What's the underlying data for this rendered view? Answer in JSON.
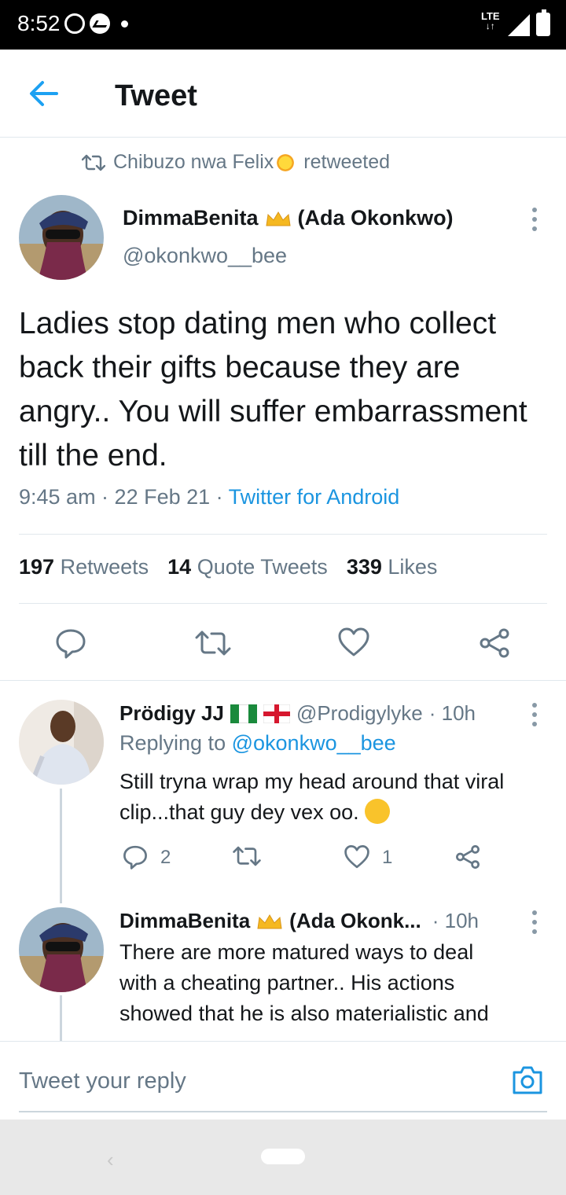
{
  "status_bar": {
    "time": "8:52",
    "network": "LTE"
  },
  "header": {
    "title": "Tweet"
  },
  "retweet_context": {
    "name": "Chibuzo nwa Felix",
    "suffix": "retweeted"
  },
  "tweet": {
    "author_name": "DimmaBenita",
    "author_name_suffix": "(Ada Okonkwo)",
    "handle": "@okonkwo__bee",
    "text": "Ladies stop dating men who collect back their gifts because they are angry.. You will suffer embarrassment till the end.",
    "time": "9:45 am · 22 Feb 21 ·",
    "source": "Twitter for Android",
    "stats": {
      "retweets": "197",
      "retweets_label": "Retweets",
      "quotes": "14",
      "quotes_label": "Quote Tweets",
      "likes": "339",
      "likes_label": "Likes"
    }
  },
  "replies": [
    {
      "name": "Prödigy JJ",
      "handle": "@Prodigylyke",
      "time": "· 10h",
      "replying_prefix": "Replying to",
      "replying_to": "@okonkwo__bee",
      "text_line1": "Still tryna wrap my head around that viral",
      "text_line2": "clip...that guy dey vex oo.",
      "reply_count": "2",
      "like_count": "1"
    },
    {
      "name": "DimmaBenita",
      "name_suffix": "(Ada Okonk...",
      "time": "· 10h",
      "text_line1": "There are more matured ways to deal",
      "text_line2": "with a cheating partner.. His actions",
      "text_line3": "showed that he is also materialistic and"
    }
  ],
  "composer": {
    "placeholder": "Tweet your reply"
  },
  "colors": {
    "accent": "#1b95e0",
    "muted": "#657786",
    "divider": "#e1e8ed"
  },
  "icons": [
    "back-arrow-icon",
    "retweet-icon",
    "reply-icon",
    "like-icon",
    "share-icon",
    "camera-icon",
    "more-icon"
  ]
}
